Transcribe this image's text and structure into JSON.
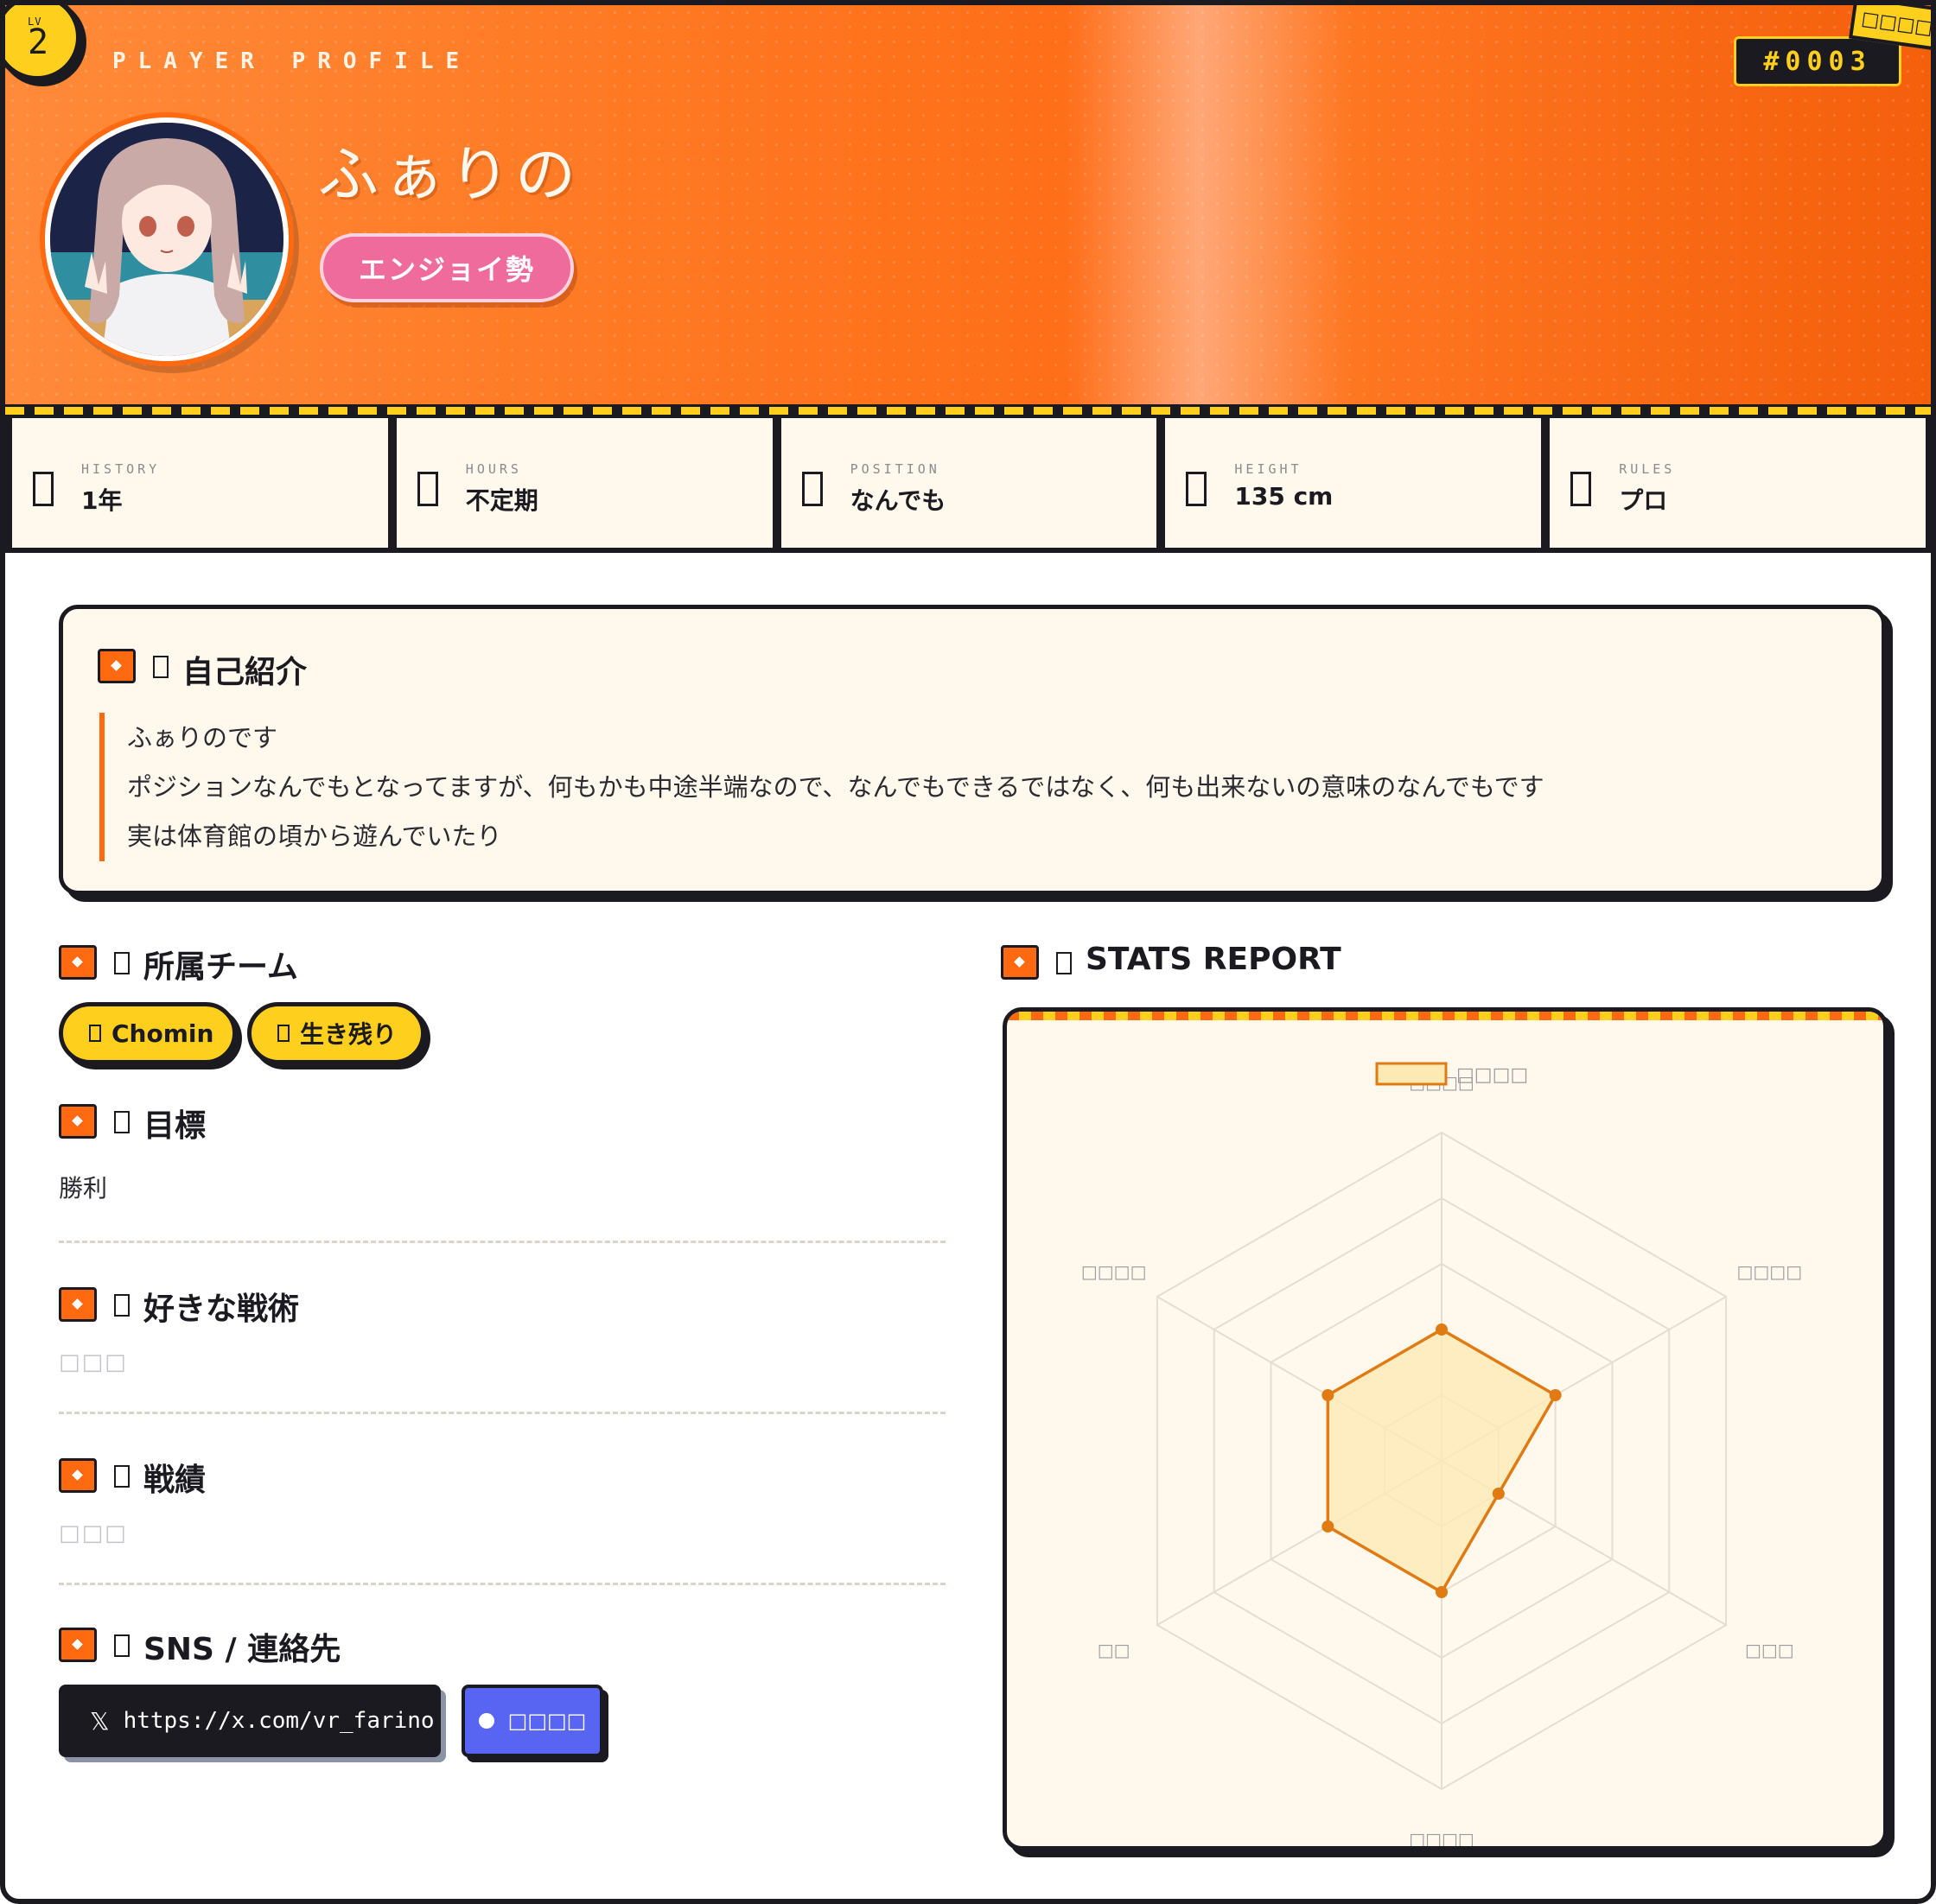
{
  "header": {
    "level_label": "LV",
    "level": "2",
    "profile_label": "PLAYER PROFILE",
    "player_name": "ふぁりの",
    "player_tag": "エンジョイ勢",
    "player_id": "#0003",
    "corner_ribbon": "□□□□"
  },
  "info": [
    {
      "label": "HISTORY",
      "value": "1年"
    },
    {
      "label": "HOURS",
      "value": "不定期"
    },
    {
      "label": "POSITION",
      "value": "なんでも"
    },
    {
      "label": "HEIGHT",
      "value": "135 cm"
    },
    {
      "label": "RULES",
      "value": "プロ"
    }
  ],
  "intro": {
    "title": "自己紹介",
    "lines": [
      "ふぁりのです",
      "ポジションなんでもとなってますが、何もかも中途半端なので、なんでもできるではなく、何も出来ないの意味のなんでもです",
      "実は体育館の頃から遊んでいたり"
    ]
  },
  "team": {
    "title": "所属チーム",
    "teams": [
      "Chomin",
      "生き残り"
    ]
  },
  "goal": {
    "title": "目標",
    "value": "勝利"
  },
  "tactics": {
    "title": "好きな戦術",
    "value": "□□□"
  },
  "record": {
    "title": "戦績",
    "value": "□□□"
  },
  "sns": {
    "title": "SNS / 連絡先",
    "x_icon": "𝕏",
    "x_url": "https://x.com/vr_farino",
    "discord_label": "□□□□"
  },
  "stats": {
    "title": "STATS REPORT",
    "colors": {
      "fill": "#fde9b3",
      "stroke": "#e07a12",
      "grid": "#e4ddd0"
    },
    "chart_data": {
      "type": "radar",
      "legend": [
        "□□□□"
      ],
      "axes": [
        "□□□□",
        "□□□□",
        "□□□",
        "□□□□",
        "□□",
        "□□□□"
      ],
      "max": 5,
      "series": [
        {
          "name": "□□□□",
          "values": [
            2,
            2,
            1,
            2,
            2,
            2
          ]
        }
      ]
    }
  }
}
